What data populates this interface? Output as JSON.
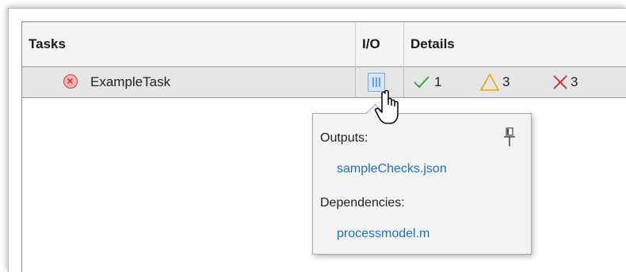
{
  "table": {
    "headers": {
      "tasks": "Tasks",
      "io": "I/O",
      "details": "Details"
    },
    "rows": [
      {
        "status_icon": "error-circle-icon",
        "task_name": "ExampleTask",
        "io_icon": "task-io-icon",
        "details": {
          "pass": {
            "icon": "check-icon",
            "count": "1",
            "color": "#2e9e2e"
          },
          "warn": {
            "icon": "warning-triangle-icon",
            "count": "3",
            "color": "#f0a500"
          },
          "fail": {
            "icon": "x-icon",
            "count": "3",
            "color": "#d22a2a"
          }
        }
      }
    ]
  },
  "popover": {
    "pin_icon": "pin-icon",
    "outputs_label": "Outputs:",
    "outputs": [
      "sampleChecks.json"
    ],
    "dependencies_label": "Dependencies:",
    "dependencies": [
      "processmodel.m"
    ],
    "link_color": "#1f6fc5"
  },
  "cursor_icon": "hand-pointer-icon"
}
